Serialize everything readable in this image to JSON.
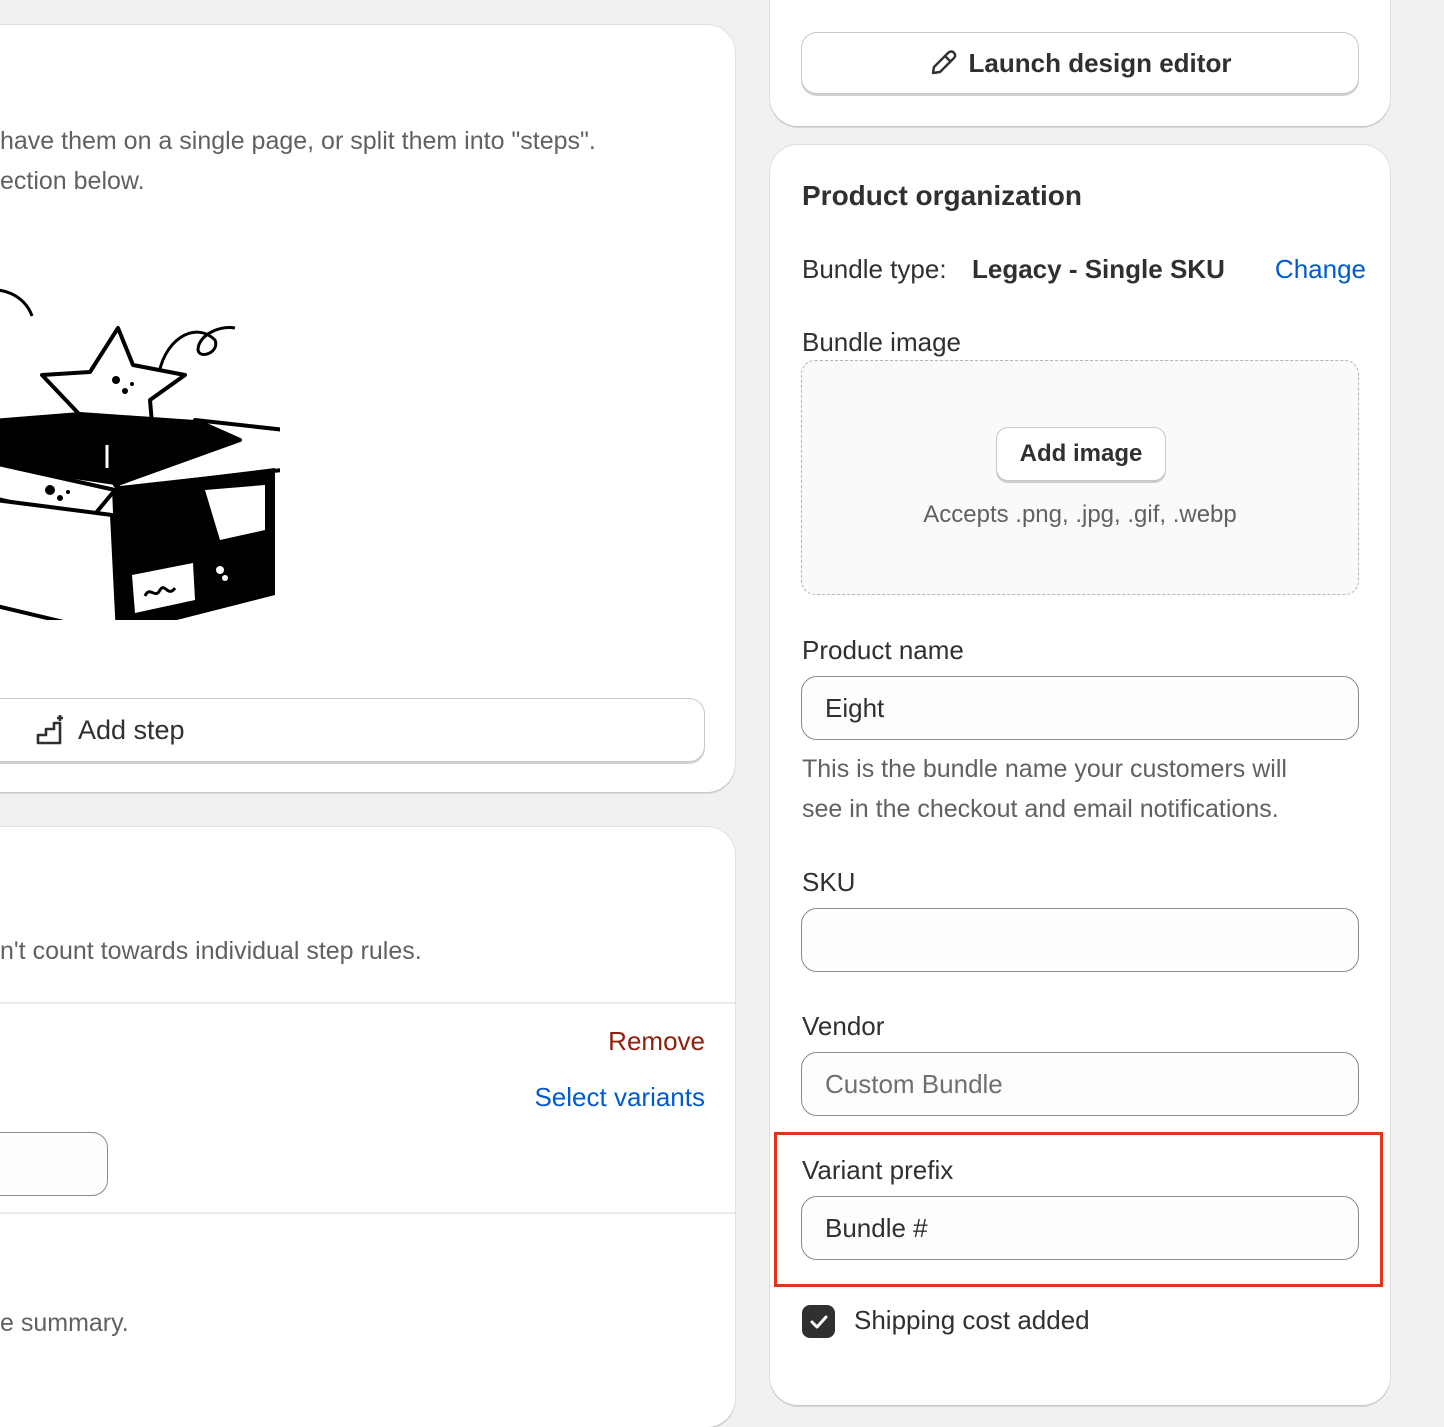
{
  "steps_card": {
    "description_line1": "have them on a single page, or split them into \"steps\".",
    "description_line2": "ection below.",
    "add_step_label": "Add step",
    "illustration_icon": "gift-box-star-illustration",
    "step_icon": "stairs-plus-icon"
  },
  "rules_card": {
    "description": "n't count towards individual step rules.",
    "remove_label": "Remove",
    "select_variants_label": "Select variants",
    "summary_text": "e summary."
  },
  "design_card": {
    "launch_label": "Launch design editor",
    "launch_icon": "pencil-icon"
  },
  "product_org": {
    "title": "Product organization",
    "bundle_type_label": "Bundle type:",
    "bundle_type_value": "Legacy - Single SKU",
    "change_label": "Change",
    "bundle_image_label": "Bundle image",
    "add_image_label": "Add image",
    "accepts_text": "Accepts .png, .jpg, .gif, .webp",
    "product_name_label": "Product name",
    "product_name_value": "Eight",
    "product_name_help_line1": "This is the bundle name your customers will",
    "product_name_help_line2": "see in the checkout and email notifications.",
    "sku_label": "SKU",
    "sku_value": "",
    "vendor_label": "Vendor",
    "vendor_placeholder": "Custom Bundle",
    "variant_prefix_label": "Variant prefix",
    "variant_prefix_value": "Bundle #",
    "shipping_label": "Shipping cost added",
    "shipping_checked": true
  },
  "colors": {
    "link": "#005bd3",
    "danger": "#8e1f0b",
    "highlight": "#e5321b",
    "checkbox": "#303030"
  }
}
